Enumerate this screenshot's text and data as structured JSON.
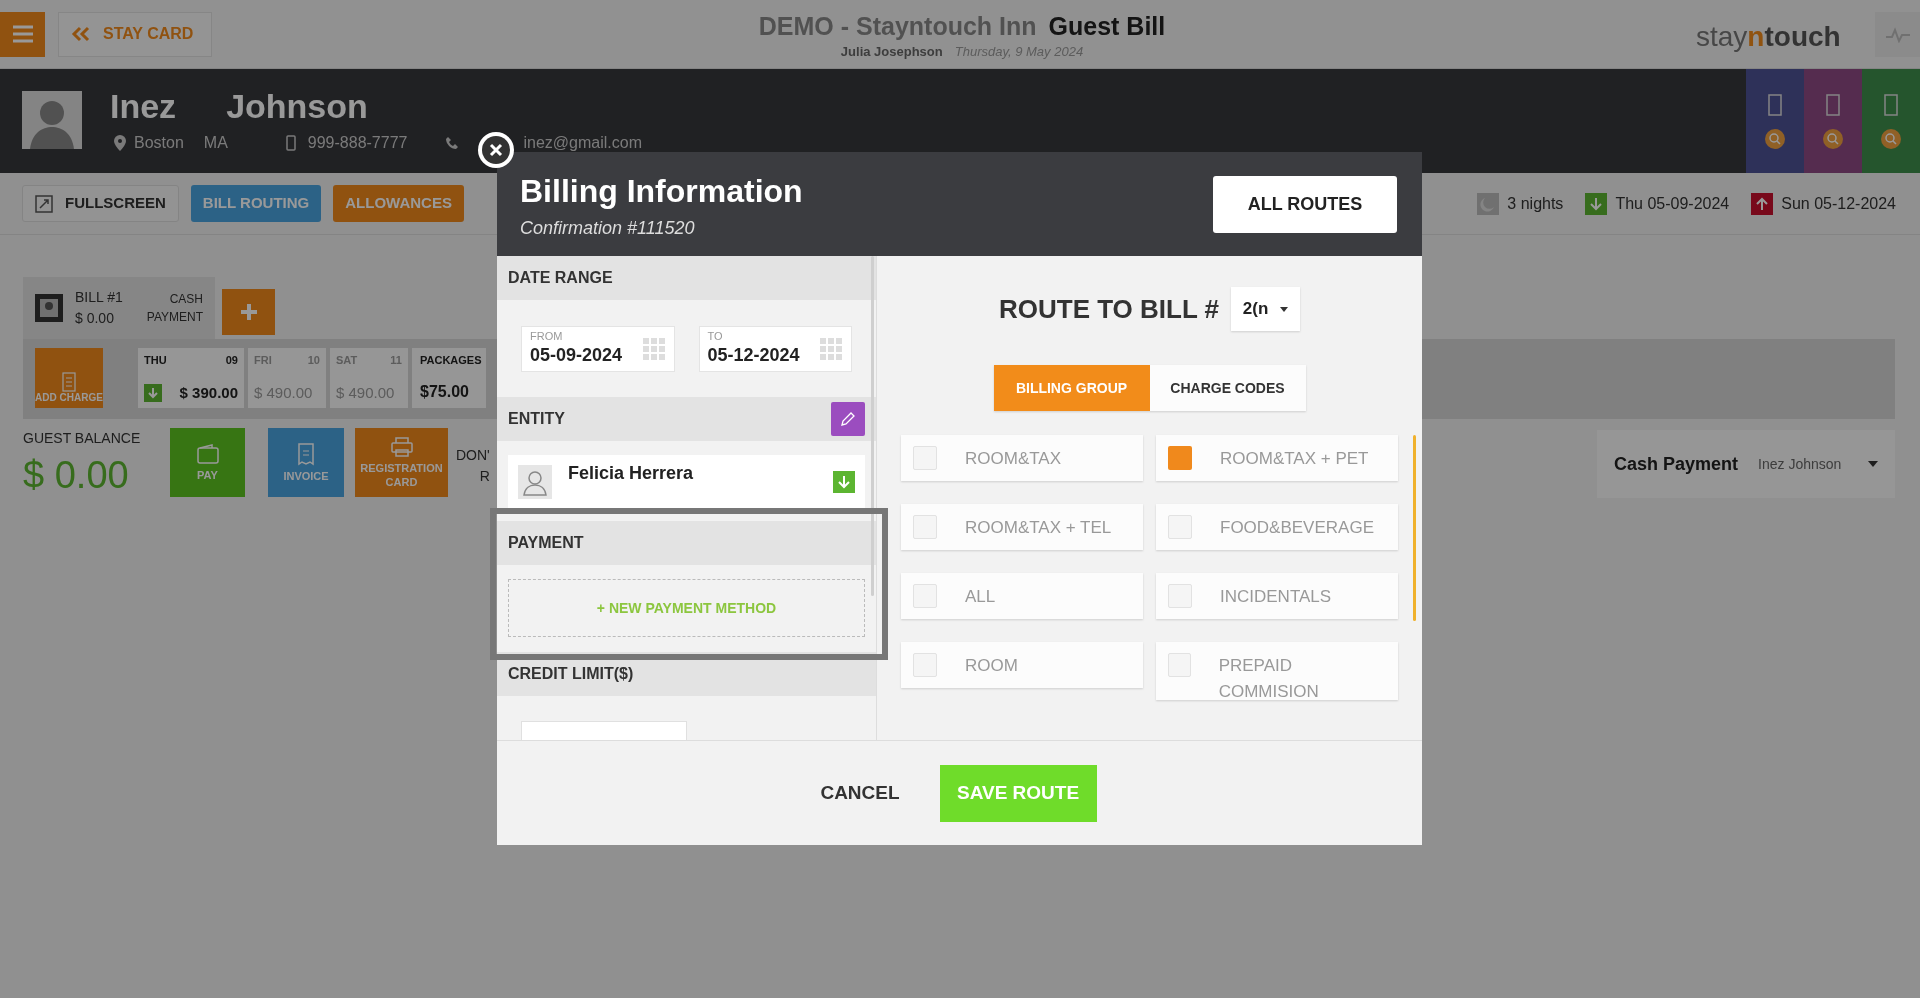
{
  "top_bar": {
    "back_button": "STAY CARD",
    "hotel": "DEMO - Stayntouch Inn",
    "page_title": "Guest Bill",
    "user": "Julia Josephson",
    "date": "Thursday, 9 May 2024",
    "logo": [
      {
        "text": "stay",
        "accent": false
      },
      {
        "text": "n",
        "accent": true
      },
      {
        "text": "touch",
        "accent": false
      }
    ]
  },
  "guest": {
    "first_name": "Inez",
    "last_name": "Johnson",
    "city": "Boston",
    "state": "MA",
    "phone": "999-888-7777",
    "email": "inez@gmail.com"
  },
  "toolbar": {
    "buttons": [
      {
        "label": "FULLSCREEN",
        "kind": "plain"
      },
      {
        "label": "BILL ROUTING",
        "kind": "blue"
      },
      {
        "label": "ALLOWANCES",
        "kind": "orange"
      }
    ],
    "stay": [
      {
        "kind": "nights",
        "text": "3 nights"
      },
      {
        "kind": "arrival",
        "text": "Thu 05-09-2024"
      },
      {
        "kind": "departure",
        "text": "Sun 05-12-2024"
      }
    ]
  },
  "bill": {
    "title": "BILL #1",
    "amount": "$ 0.00",
    "payment": "CASH PAYMENT",
    "add_charge": "ADD CHARGE",
    "days": [
      {
        "day": "THU",
        "date": "09",
        "amount": "$ 390.00",
        "current": true
      },
      {
        "day": "FRI",
        "date": "10",
        "amount": "$ 490.00",
        "current": false
      },
      {
        "day": "SAT",
        "date": "11",
        "amount": "$ 490.00",
        "current": false
      }
    ],
    "packages": {
      "label": "PACKAGES",
      "amount": "$75.00"
    }
  },
  "balance": {
    "label": "GUEST BALANCE",
    "amount": "$ 0.00"
  },
  "actions": [
    {
      "label": "PAY",
      "kind": "pay"
    },
    {
      "label": "INVOICE",
      "kind": "invoice"
    },
    {
      "label": "REGISTRATION CARD",
      "kind": "registration"
    }
  ],
  "cut_text": [
    "DON'",
    "R"
  ],
  "payment_card": {
    "method": "Cash Payment",
    "payer": "Inez Johnson"
  },
  "modal": {
    "title": "Billing Information",
    "confirmation": "Confirmation #111520",
    "all_routes": "ALL ROUTES",
    "date_range": {
      "header": "DATE RANGE",
      "from_label": "FROM",
      "from": "05-09-2024",
      "to_label": "TO",
      "to": "05-12-2024"
    },
    "entity": {
      "header": "ENTITY",
      "name": "Felicia Herrera"
    },
    "payment": {
      "header": "PAYMENT",
      "new_method": "+ NEW PAYMENT METHOD"
    },
    "credit_limit": {
      "header": "CREDIT LIMIT($)"
    },
    "route_label": "ROUTE TO BILL #",
    "route_bill": "2(n",
    "tabs": [
      {
        "label": "BILLING GROUP",
        "selected": true
      },
      {
        "label": "CHARGE CODES",
        "selected": false
      }
    ],
    "groups": [
      {
        "label": "ROOM&TAX",
        "checked": false
      },
      {
        "label": "ROOM&TAX + PET",
        "checked": true
      },
      {
        "label": "ROOM&TAX + TEL",
        "checked": false
      },
      {
        "label": "FOOD&BEVERAGE",
        "checked": false
      },
      {
        "label": "ALL",
        "checked": false
      },
      {
        "label": "INCIDENTALS",
        "checked": false
      },
      {
        "label": "ROOM",
        "checked": false
      },
      {
        "label": "PREPAID COMMISION",
        "checked": false
      }
    ],
    "cancel": "CANCEL",
    "save": "SAVE ROUTE"
  }
}
